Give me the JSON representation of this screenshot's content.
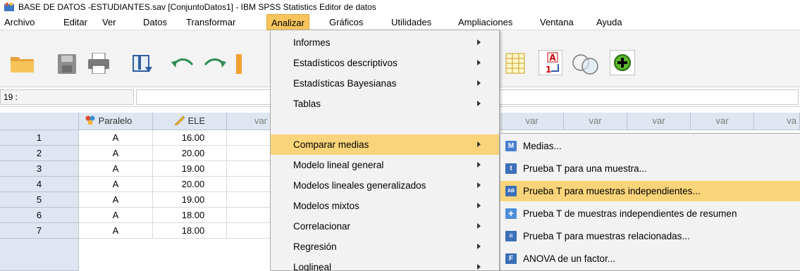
{
  "window": {
    "title": "BASE DE DATOS -ESTUDIANTES.sav [ConjuntoDatos1] - IBM SPSS Statistics Editor de datos"
  },
  "menubar": [
    "Archivo",
    "Editar",
    "Ver",
    "Datos",
    "Transformar",
    "Analizar",
    "Gráficos",
    "Utilidades",
    "Ampliaciones",
    "Ventana",
    "Ayuda"
  ],
  "active_menu": "Analizar",
  "cell_ref": "19 :",
  "columns": [
    "Paralelo",
    "ELE",
    "var",
    "var",
    "var",
    "var",
    "var",
    "var",
    "va"
  ],
  "rows": [
    {
      "n": "1",
      "paralelo": "A",
      "ele": "16.00"
    },
    {
      "n": "2",
      "paralelo": "A",
      "ele": "20.00"
    },
    {
      "n": "3",
      "paralelo": "A",
      "ele": "19.00"
    },
    {
      "n": "4",
      "paralelo": "A",
      "ele": "20.00"
    },
    {
      "n": "5",
      "paralelo": "A",
      "ele": "19.00"
    },
    {
      "n": "6",
      "paralelo": "A",
      "ele": "18.00"
    },
    {
      "n": "7",
      "paralelo": "A",
      "ele": "18.00"
    }
  ],
  "analizar_menu": [
    {
      "label": "Informes",
      "submenu": true
    },
    {
      "label": "Estadísticos descriptivos",
      "submenu": true
    },
    {
      "label": "Estadísticas Bayesianas",
      "submenu": true
    },
    {
      "label": "Tablas",
      "submenu": true
    },
    {
      "label": "Comparar medias",
      "submenu": true,
      "highlighted": true
    },
    {
      "label": "Modelo lineal general",
      "submenu": true
    },
    {
      "label": "Modelos lineales generalizados",
      "submenu": true
    },
    {
      "label": "Modelos mixtos",
      "submenu": true
    },
    {
      "label": "Correlacionar",
      "submenu": true
    },
    {
      "label": "Regresión",
      "submenu": true
    },
    {
      "label": "Loglineal",
      "submenu": true
    }
  ],
  "comparar_medias_submenu": [
    {
      "label": "Medias...",
      "icon": "medias-icon",
      "icon_text": "M",
      "icon_color": "#4a7fd1"
    },
    {
      "label": "Prueba T para una muestra...",
      "icon": "t-test-icon",
      "icon_text": "t",
      "icon_color": "#3b6fb8"
    },
    {
      "label": "Prueba T para muestras independientes...",
      "icon": "independent-t-test-icon",
      "icon_text": "AB",
      "icon_color": "#3b6fb8",
      "highlighted": true
    },
    {
      "label": "Prueba T de muestras independientes de resumen",
      "icon": "plus-icon",
      "icon_text": "+",
      "icon_color": "#4a8ed8"
    },
    {
      "label": "Prueba T para muestras relacionadas...",
      "icon": "paired-t-test-icon",
      "icon_text": "≡",
      "icon_color": "#3b6fb8"
    },
    {
      "label": "ANOVA de un factor...",
      "icon": "anova-icon",
      "icon_text": "F",
      "icon_color": "#3b6fb8"
    }
  ]
}
